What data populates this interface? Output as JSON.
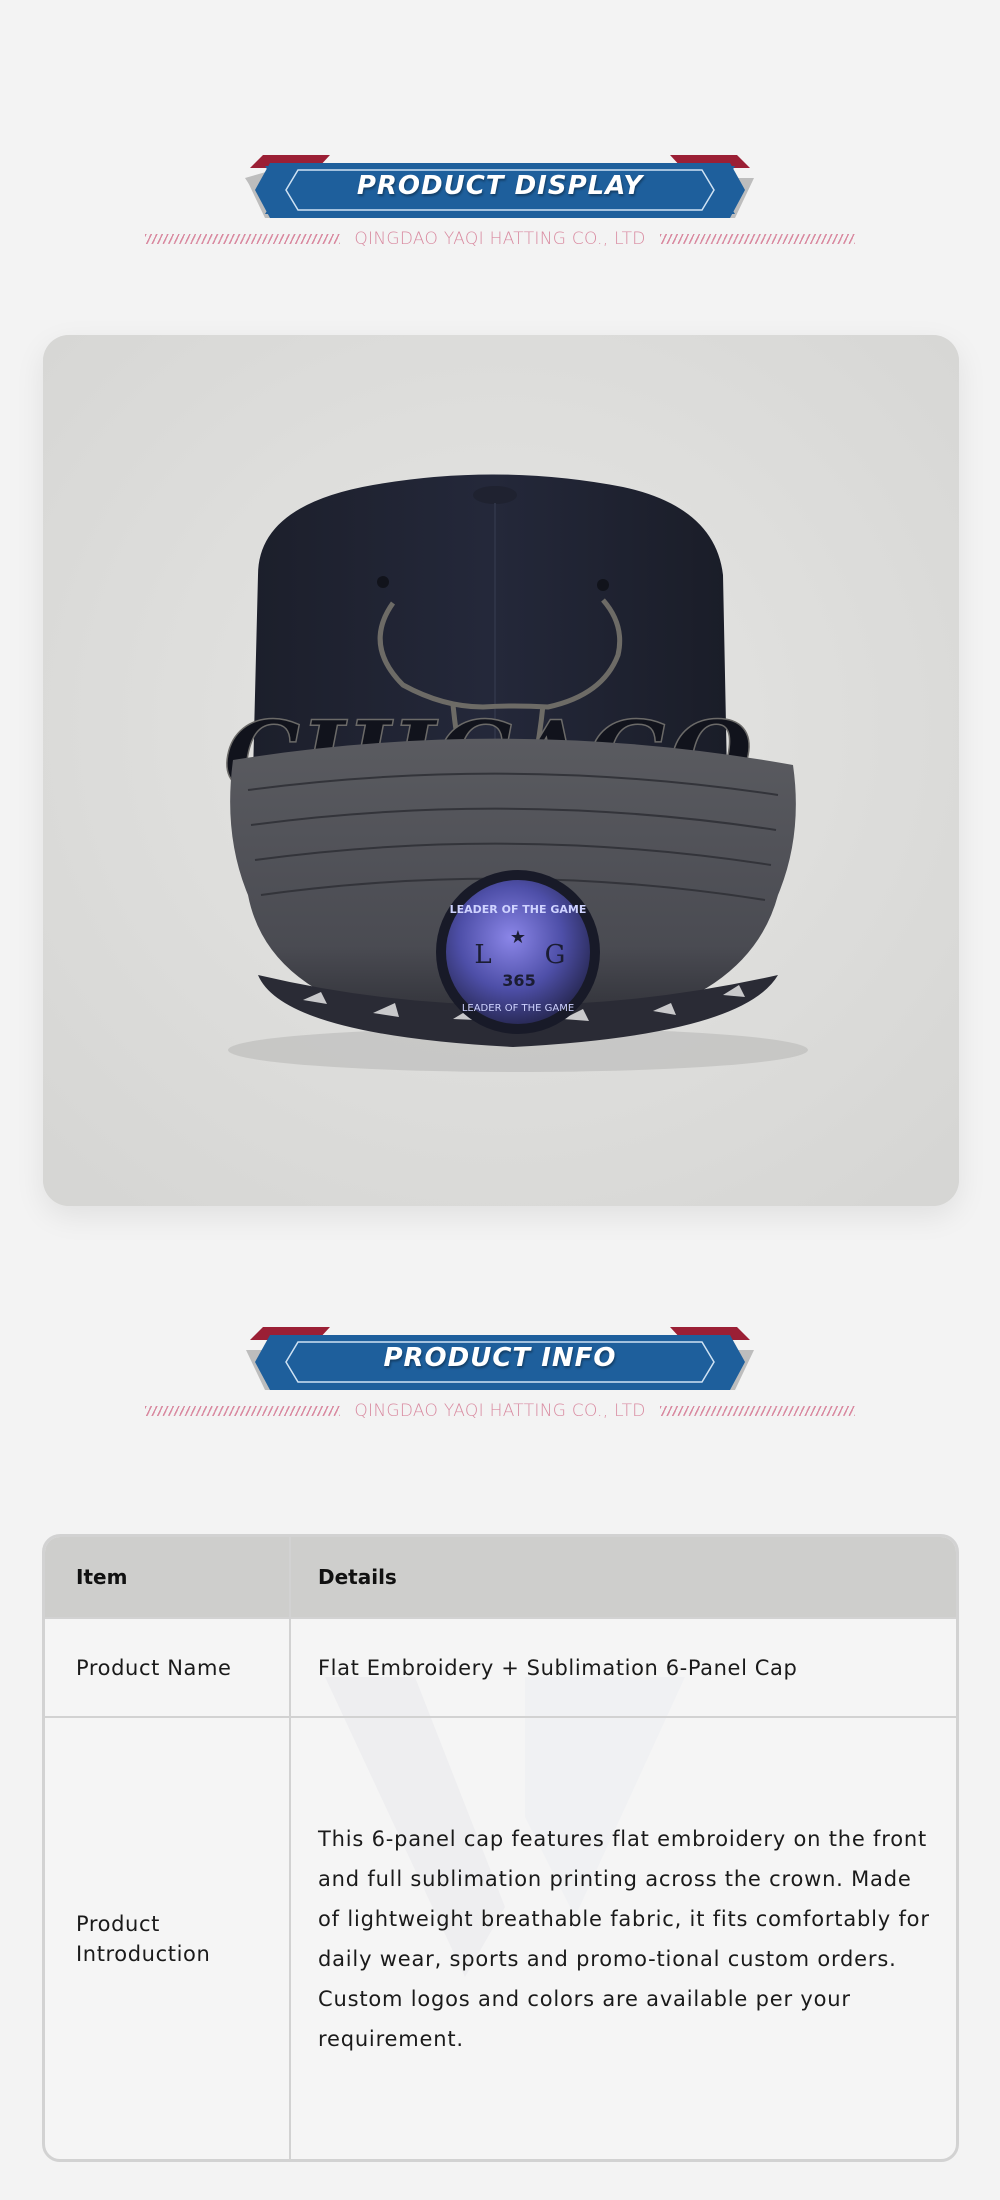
{
  "display_section": {
    "title": "PRODUCT DISPLAY",
    "subtitle": "QINGDAO YAQI HATTING CO., LTD"
  },
  "product_image": {
    "icon": "baseball-cap-photo",
    "embroidery_text": "CHICAGO",
    "patch_top": "LEADER OF THE GAME",
    "patch_letters_left": "L",
    "patch_letters_right": "G",
    "patch_number": "365",
    "patch_bottom": "LEADER OF THE GAME"
  },
  "info_section": {
    "title": "PRODUCT INFO",
    "subtitle": "QINGDAO YAQI HATTING CO., LTD"
  },
  "table": {
    "header_item": "Item",
    "header_details": "Details",
    "rows": [
      {
        "label": "Product Name",
        "value": "Flat Embroidery + Sublimation 6-Panel Cap"
      },
      {
        "label": "Product Introduction",
        "value": "This 6-panel cap features flat embroidery on the front and full sublimation printing across the crown. Made of lightweight breathable fabric, it fits comfortably for daily wear, sports and promo-tional custom orders. Custom logos and colors are available per your requirement."
      }
    ]
  },
  "colors": {
    "banner_blue": "#1e5f9c",
    "banner_red": "#9b1f35",
    "banner_gray": "#bdbdbd",
    "subtitle_pink": "#d98aa0",
    "page_bg": "#f3f3f3"
  }
}
